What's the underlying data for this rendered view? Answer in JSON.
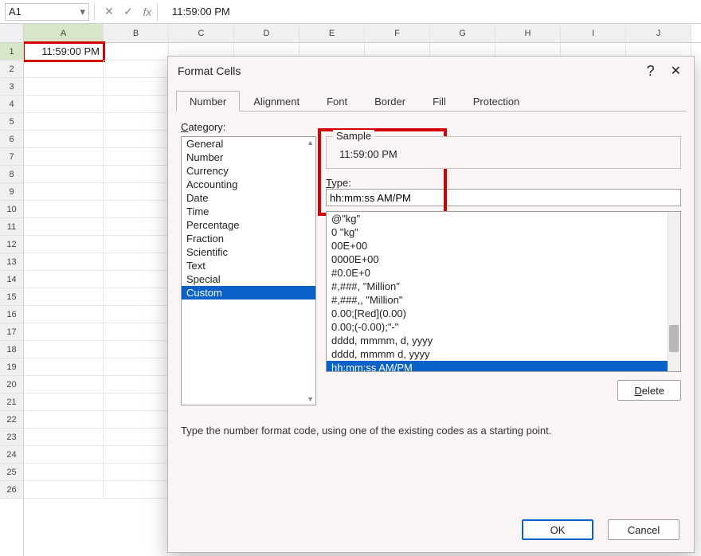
{
  "formula_bar": {
    "name_box": "A1",
    "cancel_icon": "✕",
    "confirm_icon": "✓",
    "fx_icon": "fx",
    "formula": "11:59:00 PM"
  },
  "columns": [
    "A",
    "B",
    "C",
    "D",
    "E",
    "F",
    "G",
    "H",
    "I",
    "J"
  ],
  "rows": [
    "1",
    "2",
    "3",
    "4",
    "5",
    "6",
    "7",
    "8",
    "9",
    "10",
    "11",
    "12",
    "13",
    "14",
    "15",
    "16",
    "17",
    "18",
    "19",
    "20",
    "21",
    "22",
    "23",
    "24",
    "25",
    "26"
  ],
  "cell_a1_value": "11:59:00 PM",
  "dialog": {
    "title": "Format Cells",
    "help": "?",
    "close": "✕",
    "tabs": {
      "number": "Number",
      "alignment": "Alignment",
      "font": "Font",
      "border": "Border",
      "fill": "Fill",
      "protection": "Protection"
    },
    "category_label": "Category:",
    "categories": [
      "General",
      "Number",
      "Currency",
      "Accounting",
      "Date",
      "Time",
      "Percentage",
      "Fraction",
      "Scientific",
      "Text",
      "Special",
      "Custom"
    ],
    "sample_label": "Sample",
    "sample_value": "11:59:00 PM",
    "type_label": "Type:",
    "type_value": "hh:mm:ss AM/PM",
    "codes": [
      "@\"kg\"",
      "0 \"kg\"",
      "00E+00",
      "0000E+00",
      "#0.0E+0",
      "#,###, \"Million\"",
      "#,###,, \"Million\"",
      "0.00;[Red](0.00)",
      "0.00;(-0.00);\"-\"",
      "dddd, mmmm, d, yyyy",
      "dddd, mmmm d, yyyy",
      "hh:mm:ss AM/PM"
    ],
    "delete_label": "Delete",
    "hint": "Type the number format code, using one of the existing codes as a starting point.",
    "ok_label": "OK",
    "cancel_label": "Cancel"
  }
}
